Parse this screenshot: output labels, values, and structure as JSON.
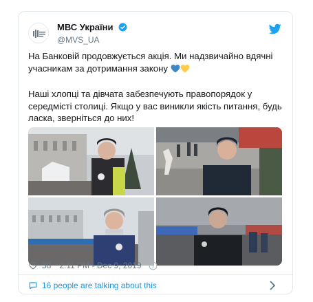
{
  "tweet": {
    "display_name": "МВС України",
    "handle": "@MVS_UA",
    "paragraph1": "На Банковій продовжується акція. Ми надзвичайно вдячні учасникам за дотримання закону",
    "paragraph2": "Наші хлопці та дівчата забезпечують правопорядок у середмісті столиці. Якщо у вас виникли якість питання, будь ласка, зверніться до них!",
    "likes": "38",
    "timestamp": "2:11 PM - Dec 9, 2019",
    "talking": "16 people are talking about this"
  },
  "icons": {
    "logo": "twitter-bird-icon",
    "verified": "verified-badge-icon",
    "like": "heart-icon",
    "info": "info-icon",
    "reply": "speech-bubble-icon",
    "chevron": "chevron-right-icon"
  },
  "colors": {
    "accent": "#1da1f2",
    "link": "#1b95e0",
    "muted": "#657786",
    "heart_blue": "#3b88c3",
    "heart_yellow": "#ffcc4d"
  }
}
